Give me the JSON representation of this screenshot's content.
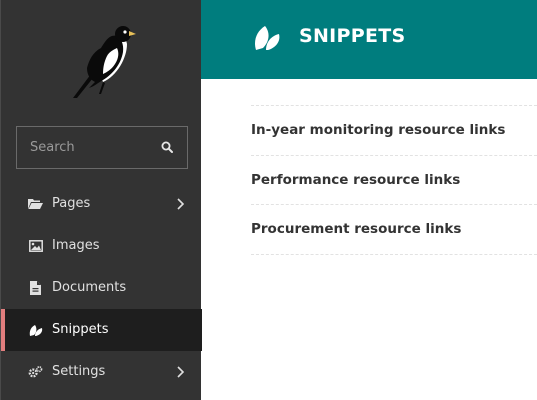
{
  "sidebar": {
    "logo": "wagtail-bird-logo",
    "search": {
      "placeholder": "Search",
      "value": ""
    },
    "items": [
      {
        "label": "Pages",
        "icon": "folder-open-icon",
        "has_submenu": true,
        "active": false
      },
      {
        "label": "Images",
        "icon": "image-icon",
        "has_submenu": false,
        "active": false
      },
      {
        "label": "Documents",
        "icon": "document-icon",
        "has_submenu": false,
        "active": false
      },
      {
        "label": "Snippets",
        "icon": "snippet-leaf-icon",
        "has_submenu": false,
        "active": true
      },
      {
        "label": "Settings",
        "icon": "cogs-icon",
        "has_submenu": true,
        "active": false
      }
    ]
  },
  "header": {
    "title": "SNIPPETS",
    "icon": "snippet-leaf-icon"
  },
  "snippets": [
    {
      "label": "In-year monitoring resource links"
    },
    {
      "label": "Performance resource links"
    },
    {
      "label": "Procurement resource links"
    }
  ],
  "colors": {
    "sidebar_bg": "#333333",
    "active_item_bg": "#1e1e1e",
    "active_indicator": "#e27e7e",
    "header_bg": "#007d7e",
    "header_text": "#ffffff",
    "link_text": "#333333"
  }
}
